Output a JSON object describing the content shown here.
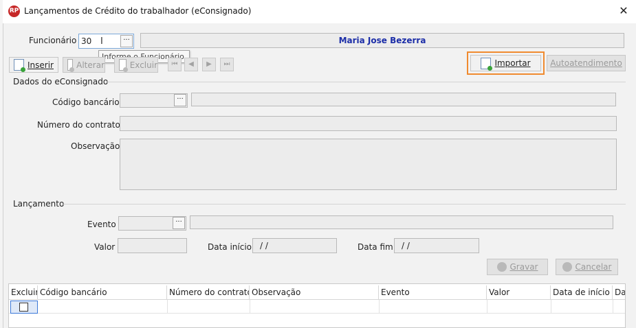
{
  "window": {
    "title": "Lançamentos de Crédito do trabalhador (eConsignado)",
    "logo_text": "RP",
    "close_glyph": "✕"
  },
  "funcionario": {
    "label": "Funcionário",
    "code_value": "30",
    "name": "Maria Jose Bezerra",
    "tooltip": "Informe o Funcionário"
  },
  "toolbar": {
    "inserir": "Inserir",
    "alterar": "Alterar",
    "excluir": "Excluir",
    "importar": "Importar",
    "autoatendimento": "Autoatendimento",
    "nav": [
      "⏮",
      "◀",
      "▶",
      "⏭"
    ]
  },
  "dados": {
    "section_title": "Dados do eConsignado",
    "codigo_bancario_label": "Código bancário",
    "numero_contrato_label": "Número do contrato",
    "observacao_label": "Observação"
  },
  "lancamento": {
    "section_title": "Lançamento",
    "evento_label": "Evento",
    "valor_label": "Valor",
    "data_inicio_label": "Data início",
    "data_inicio_value": "/ /",
    "data_fim_label": "Data fim",
    "data_fim_value": "/ /",
    "gravar": "Gravar",
    "cancelar": "Cancelar"
  },
  "grid": {
    "columns": [
      "Excluir",
      "Código bancário",
      "Número do contrato",
      "Observação",
      "Evento",
      "Valor",
      "Data de início",
      "Da"
    ]
  },
  "colors": {
    "accent_highlight": "#f08a2e",
    "name_blue": "#1c2ea8"
  }
}
